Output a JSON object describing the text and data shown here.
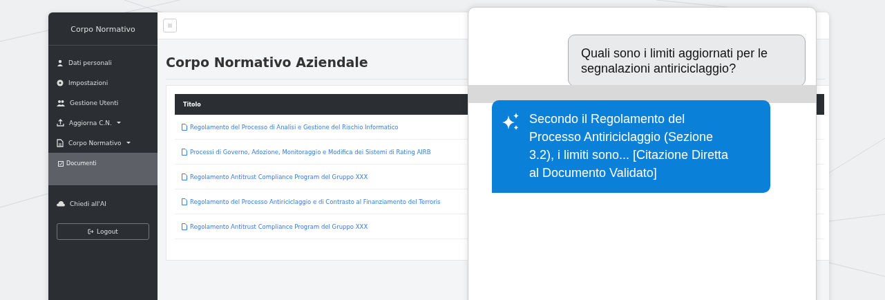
{
  "sidebar": {
    "title": "Corpo Normativo",
    "items": [
      {
        "label": "Dati personali",
        "kind": "link"
      },
      {
        "label": "Impostazioni",
        "kind": "link"
      },
      {
        "label": "Gestione Utenti",
        "kind": "link"
      },
      {
        "label": "Aggiorna C.N.",
        "kind": "dropdown"
      },
      {
        "label": "Corpo Normativo",
        "kind": "dropdown",
        "expanded": true,
        "children": [
          {
            "label": "Documenti"
          }
        ]
      },
      {
        "label": "Chiedi all'AI",
        "kind": "link"
      }
    ],
    "logout": "Logout"
  },
  "page_title": "Corpo Normativo Aziendale",
  "table": {
    "columns": [
      "Titolo"
    ],
    "rows": [
      {
        "title": "Regolamento del Processo di Analisi e Gestione del Rischio Informatico"
      },
      {
        "title": "Processi di Governo, Adozione, Monitoraggio e Modifica dei Sistemi di Rating AIRB"
      },
      {
        "title": "Regolamento Antitrust Compliance Program del Gruppo XXX"
      },
      {
        "title": "Regolamento del Processo Antiriciclaggio e di Contrasto al Finanziamento del Terroris"
      },
      {
        "title": "Regolamento Antitrust Compliance Program del Gruppo XXX"
      }
    ]
  },
  "chat": {
    "messages": [
      {
        "kind": "question",
        "text": "Quali sono i limiti aggiornati per le segnalazioni antiriciclaggio?"
      },
      {
        "kind": "answer",
        "text": "Secondo il Regolamento del Processo Antiriciclaggio (Sezione 3.2), i limiti sono... [Citazione Diretta al Documento Validato]"
      }
    ]
  }
}
